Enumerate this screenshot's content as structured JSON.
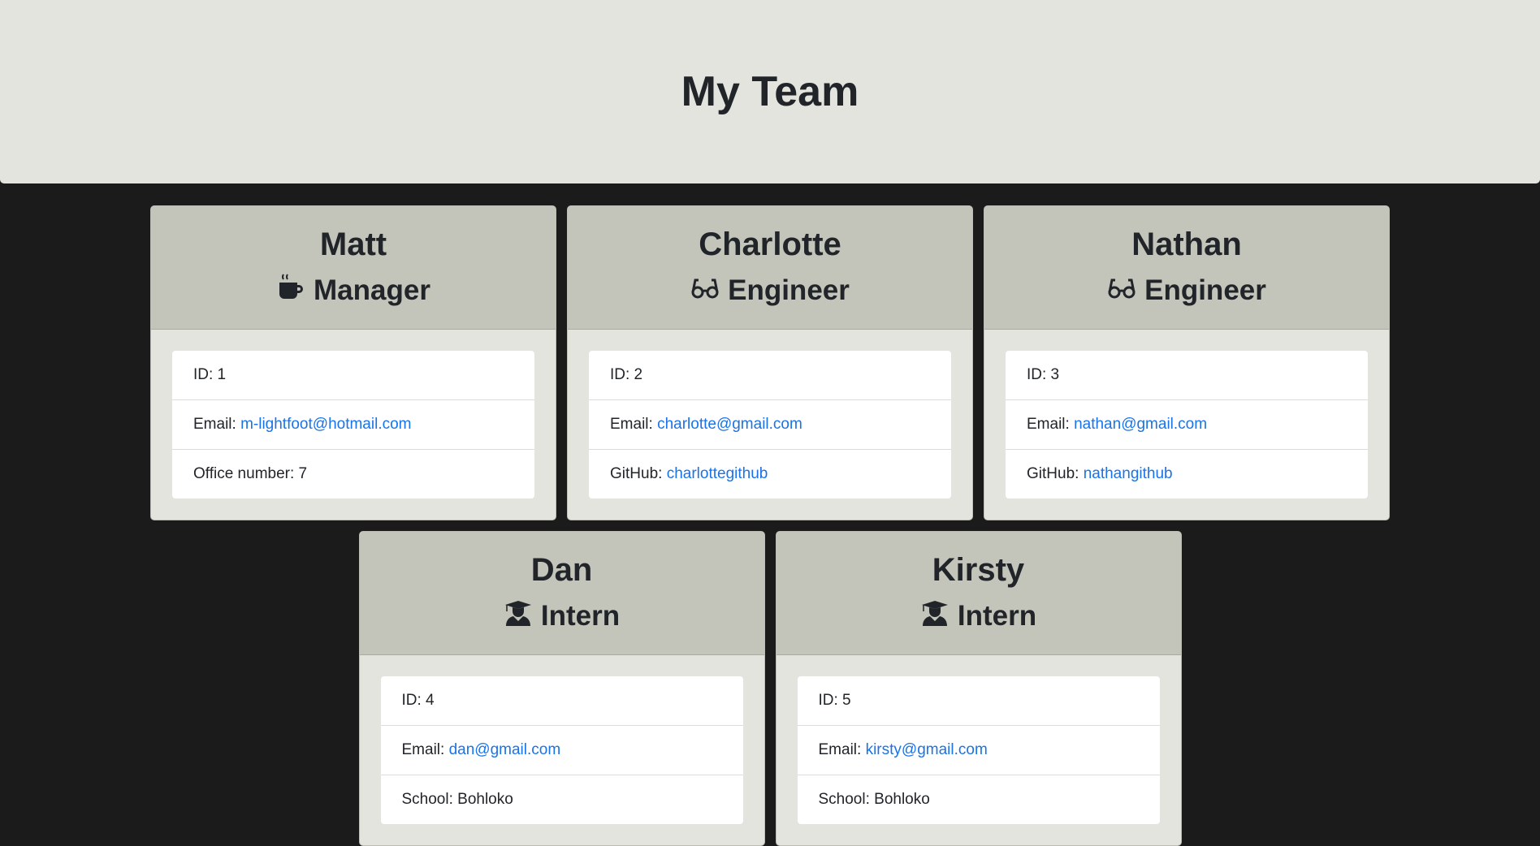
{
  "header": {
    "title": "My Team"
  },
  "colors": {
    "header_bg": "#e3e4de",
    "card_header_bg": "#c3c4ba",
    "page_bg": "#1b1b1b",
    "link": "#1a73e8"
  },
  "cards": [
    {
      "name": "Matt",
      "role": "Manager",
      "icon": "coffee-icon",
      "id": "ID: 1",
      "email_label": "Email: ",
      "email": "m-lightfoot@hotmail.com",
      "extra_label": "Office number: ",
      "extra": "7"
    },
    {
      "name": "Charlotte",
      "role": "Engineer",
      "icon": "glasses-icon",
      "id": "ID: 2",
      "email_label": "Email: ",
      "email": "charlotte@gmail.com",
      "extra_label": "GitHub: ",
      "extra": "charlottegithub"
    },
    {
      "name": "Nathan",
      "role": "Engineer",
      "icon": "glasses-icon",
      "id": "ID: 3",
      "email_label": "Email: ",
      "email": "nathan@gmail.com",
      "extra_label": "GitHub: ",
      "extra": "nathangithub"
    },
    {
      "name": "Dan",
      "role": "Intern",
      "icon": "graduate-icon",
      "id": "ID: 4",
      "email_label": "Email: ",
      "email": "dan@gmail.com",
      "extra_label": "School: ",
      "extra": "Bohloko"
    },
    {
      "name": "Kirsty",
      "role": "Intern",
      "icon": "graduate-icon",
      "id": "ID: 5",
      "email_label": "Email: ",
      "email": "kirsty@gmail.com",
      "extra_label": "School: ",
      "extra": "Bohloko"
    }
  ]
}
